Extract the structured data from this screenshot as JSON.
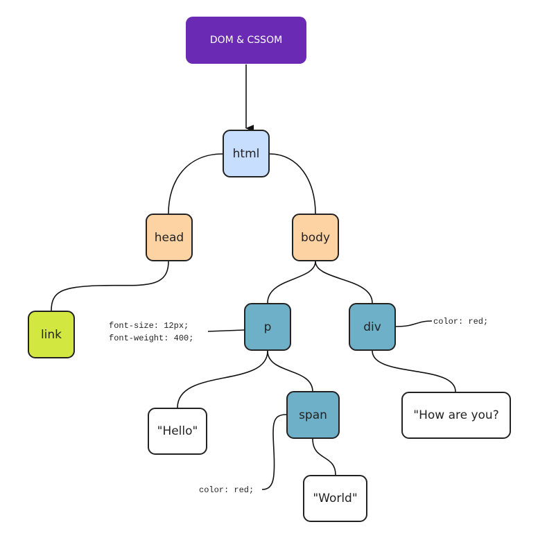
{
  "title": {
    "label": "DOM & CSSOM",
    "color": "#6a2ab3"
  },
  "colors": {
    "html": "#c8defe",
    "head": "#fed3a4",
    "body": "#fed3a4",
    "link": "#d2e841",
    "element": "#6eb0c8",
    "text": "#ffffff"
  },
  "nodes": {
    "html": "html",
    "head": "head",
    "body": "body",
    "link": "link",
    "p": "p",
    "div": "div",
    "span": "span",
    "hello": "\"Hello\"",
    "world": "\"World\"",
    "how_are_you": "\"How are you?"
  },
  "notes": {
    "p_styles": "font-size: 12px;\nfont-weight: 400;",
    "div_styles": "color: red;",
    "span_styles": "color: red;"
  }
}
